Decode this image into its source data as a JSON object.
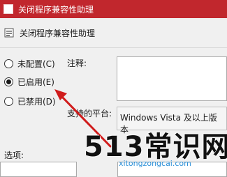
{
  "window": {
    "title": "关闭程序兼容性助理",
    "accent_color": "#c1272d"
  },
  "header": {
    "text": "关闭程序兼容性助理"
  },
  "options": [
    {
      "label": "未配置(C)",
      "checked": false
    },
    {
      "label": "已启用(E)",
      "checked": true
    },
    {
      "label": "已禁用(D)",
      "checked": false
    }
  ],
  "comment": {
    "label": "注释:",
    "value": ""
  },
  "supported": {
    "label": "支持的平台:",
    "value": "Windows Vista 及以上版本"
  },
  "options_section": {
    "label": "选项:"
  },
  "icons": {
    "app": "app-icon",
    "policy": "policy-icon"
  },
  "watermark": {
    "main": "513常识网",
    "url": "xitongzongcai.com",
    "url_color": "#2a8fd8"
  }
}
